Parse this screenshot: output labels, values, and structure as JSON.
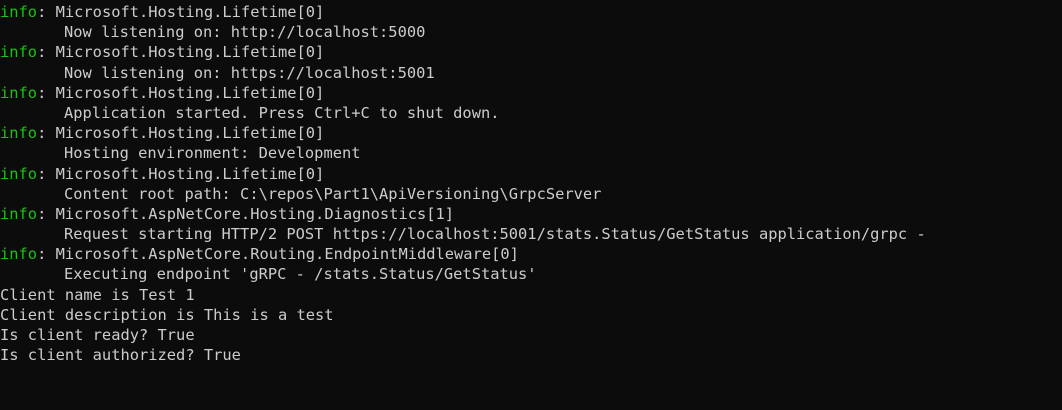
{
  "colors": {
    "background": "#0c0c0c",
    "text": "#cccccc",
    "info_level": "#16c60c"
  },
  "log": [
    {
      "level": "info",
      "source": ": Microsoft.Hosting.Lifetime[0]",
      "message": "Now listening on: http://localhost:5000"
    },
    {
      "level": "info",
      "source": ": Microsoft.Hosting.Lifetime[0]",
      "message": "Now listening on: https://localhost:5001"
    },
    {
      "level": "info",
      "source": ": Microsoft.Hosting.Lifetime[0]",
      "message": "Application started. Press Ctrl+C to shut down."
    },
    {
      "level": "info",
      "source": ": Microsoft.Hosting.Lifetime[0]",
      "message": "Hosting environment: Development"
    },
    {
      "level": "info",
      "source": ": Microsoft.Hosting.Lifetime[0]",
      "message": "Content root path: C:\\repos\\Part1\\ApiVersioning\\GrpcServer"
    },
    {
      "level": "info",
      "source": ": Microsoft.AspNetCore.Hosting.Diagnostics[1]",
      "message": "Request starting HTTP/2 POST https://localhost:5001/stats.Status/GetStatus application/grpc -"
    },
    {
      "level": "info",
      "source": ": Microsoft.AspNetCore.Routing.EndpointMiddleware[0]",
      "message": "Executing endpoint 'gRPC - /stats.Status/GetStatus'"
    }
  ],
  "client_output": [
    "Client name is Test 1",
    "Client description is This is a test",
    "Is client ready? True",
    "Is client authorized? True"
  ]
}
